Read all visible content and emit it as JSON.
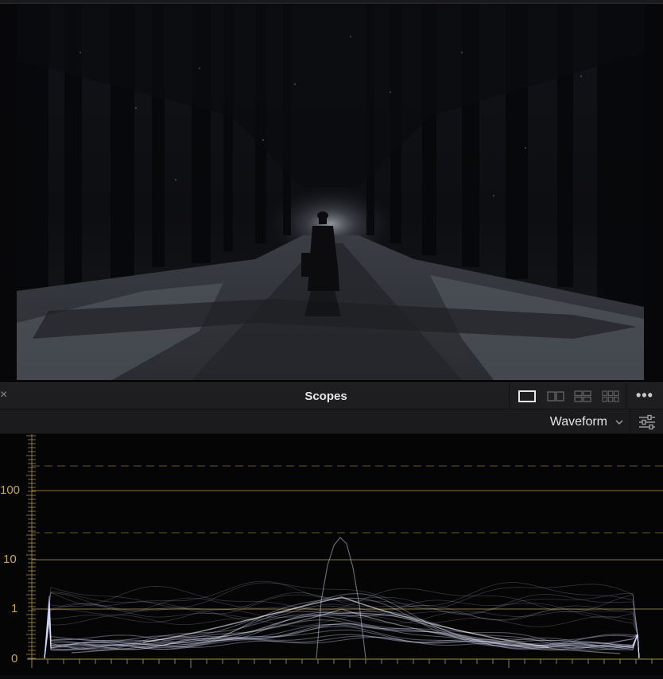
{
  "panel": {
    "close_glyph": "×",
    "title": "Scopes",
    "layout_buttons": [
      "single-view-icon",
      "dual-view-icon",
      "quad-view-icon",
      "grid-view-icon"
    ],
    "more_glyph": "•••"
  },
  "scope_selector": {
    "selected": "Waveform",
    "chevron": "chevron-down-icon",
    "settings": "sliders-icon"
  },
  "scale": {
    "labels": [
      "100",
      "10",
      "1",
      "0"
    ],
    "grid_color": "#b99a55"
  },
  "colors": {
    "panel_bg": "#1e1e20",
    "scope_bg": "#050505",
    "trace": "#d9deff"
  }
}
